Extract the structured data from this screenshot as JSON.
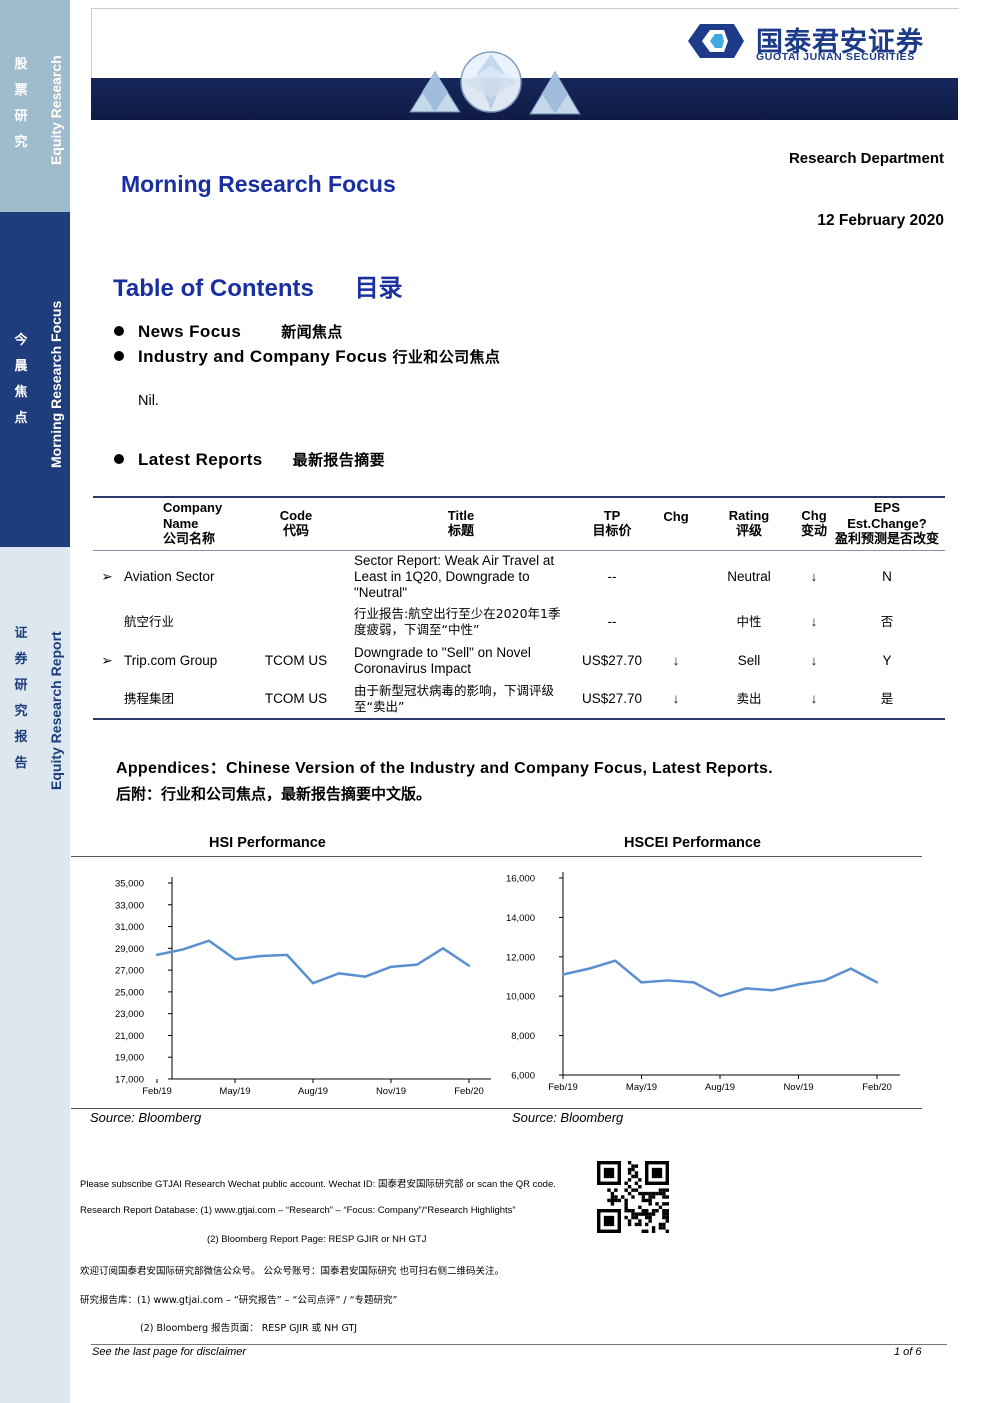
{
  "sidebar": {
    "top_cn": [
      "股",
      "票",
      "研",
      "究"
    ],
    "top_en": "Equity Research",
    "mid_cn": [
      "今",
      "晨",
      "焦",
      "点"
    ],
    "mid_en": "Morning Research Focus",
    "bot_cn": [
      "证",
      "券",
      "研",
      "究",
      "报",
      "告"
    ],
    "bot_en": "Equity Research Report"
  },
  "header": {
    "logo_cn": "国泰君安证券",
    "logo_en": "GUOTAI JUNAN SECURITIES",
    "department": "Research Department",
    "title": "Morning Research Focus",
    "date": "12 February 2020"
  },
  "toc": {
    "title_en": "Table of Contents",
    "title_cn": "目录",
    "item1_en": "News Focus",
    "item1_cn": "新闻焦点",
    "item2_en": "Industry and Company Focus",
    "item2_cn": "行业和公司焦点",
    "nil": "Nil.",
    "item3_en": "Latest Reports",
    "item3_cn": "最新报告摘要"
  },
  "table": {
    "headers": {
      "company": [
        "Company",
        "Name",
        "公司名称"
      ],
      "code": [
        "Code",
        "代码"
      ],
      "title": [
        "Title",
        "标题"
      ],
      "tp": [
        "TP",
        "目标价"
      ],
      "chg1": "Chg",
      "rating": [
        "Rating",
        "评级"
      ],
      "chg2": [
        "Chg",
        "变动"
      ],
      "eps": [
        "EPS",
        "Est.Change?",
        "盈利预测是否改变"
      ]
    },
    "rows": [
      {
        "marker": "➢",
        "company": "Aviation Sector",
        "code": "",
        "title": "Sector Report: Weak Air Travel at Least in 1Q20, Downgrade to \"Neutral\"",
        "tp": "--",
        "chg1": "",
        "rating": "Neutral",
        "chg2": "↓",
        "eps": "N"
      },
      {
        "marker": "",
        "company": "航空行业",
        "code": "",
        "title": "行业报告:航空出行至少在2020年1季度疲弱，下调至“中性”",
        "tp": "--",
        "chg1": "",
        "rating": "中性",
        "chg2": "↓",
        "eps": "否"
      },
      {
        "marker": "➢",
        "company": "Trip.com Group",
        "code": "TCOM US",
        "title": "Downgrade to \"Sell\" on Novel Coronavirus Impact",
        "tp": "US$27.70",
        "chg1": "↓",
        "rating": "Sell",
        "chg2": "↓",
        "eps": "Y"
      },
      {
        "marker": "",
        "company": "携程集团",
        "code": "TCOM US",
        "title": "由于新型冠状病毒的影响，下调评级至“卖出”",
        "tp": "US$27.70",
        "chg1": "↓",
        "rating": "卖出",
        "chg2": "↓",
        "eps": "是"
      }
    ]
  },
  "appendix": {
    "en_label": "Appendices",
    "en_text": "Chinese Version of the Industry and Company Focus, Latest Reports.",
    "cn_text": "后附：行业和公司焦点，最新报告摘要中文版。"
  },
  "chart_data": [
    {
      "type": "line",
      "title": "HSI Performance",
      "x_ticks": [
        "Feb/19",
        "May/19",
        "Aug/19",
        "Nov/19",
        "Feb/20"
      ],
      "y_ticks": [
        "35,000",
        "33,000",
        "31,000",
        "29,000",
        "27,000",
        "25,000",
        "23,000",
        "21,000",
        "19,000",
        "17,000"
      ],
      "ylim": [
        17000,
        35000
      ],
      "series": [
        {
          "color": "#5b8fd0",
          "x": [
            "2019-02",
            "2019-03",
            "2019-04",
            "2019-05",
            "2019-06",
            "2019-07",
            "2019-08",
            "2019-09",
            "2019-10",
            "2019-11",
            "2019-12",
            "2020-01",
            "2020-02"
          ],
          "values": [
            28400,
            28900,
            29700,
            28000,
            28300,
            28400,
            25800,
            26700,
            26400,
            27300,
            27500,
            29000,
            27400
          ]
        }
      ],
      "source": "Source: Bloomberg"
    },
    {
      "type": "line",
      "title": "HSCEI Performance",
      "x_ticks": [
        "Feb/19",
        "May/19",
        "Aug/19",
        "Nov/19",
        "Feb/20"
      ],
      "y_ticks": [
        "16,000",
        "14,000",
        "12,000",
        "10,000",
        "8,000",
        "6,000"
      ],
      "ylim": [
        6000,
        16000
      ],
      "series": [
        {
          "color": "#5b8fd0",
          "x": [
            "2019-02",
            "2019-03",
            "2019-04",
            "2019-05",
            "2019-06",
            "2019-07",
            "2019-08",
            "2019-09",
            "2019-10",
            "2019-11",
            "2019-12",
            "2020-01",
            "2020-02"
          ],
          "values": [
            11100,
            11400,
            11800,
            10700,
            10800,
            10700,
            10000,
            10400,
            10300,
            10600,
            10800,
            11400,
            10700
          ]
        }
      ],
      "source": "Source: Bloomberg"
    }
  ],
  "footer": {
    "line1": "Please subscribe GTJAI Research Wechat public account. Wechat ID: 国泰君安国际研究部 or scan the QR code.",
    "line2": "Research Report Database: (1) www.gtjai.com    – “Research”   – “Focus: Company”/“Research Highlights”",
    "line3": "(2) Bloomberg Report Page: RESP GJIR or NH GTJ",
    "line4": "欢迎订阅国泰君安国际研究部微信公众号。  公众号账号：国泰君安国际研究  也可扫右侧二维码关注。",
    "line5": "研究报告库：(1) www.gtjai.com   –  “研究报告”  –  “公司点评” / “专题研究”",
    "line6": "(2) Bloomberg 报告页面：   RESP GJIR  或  NH GTJ",
    "disclaimer": "See  the last page for disclaimer",
    "page": "1 of 6"
  }
}
